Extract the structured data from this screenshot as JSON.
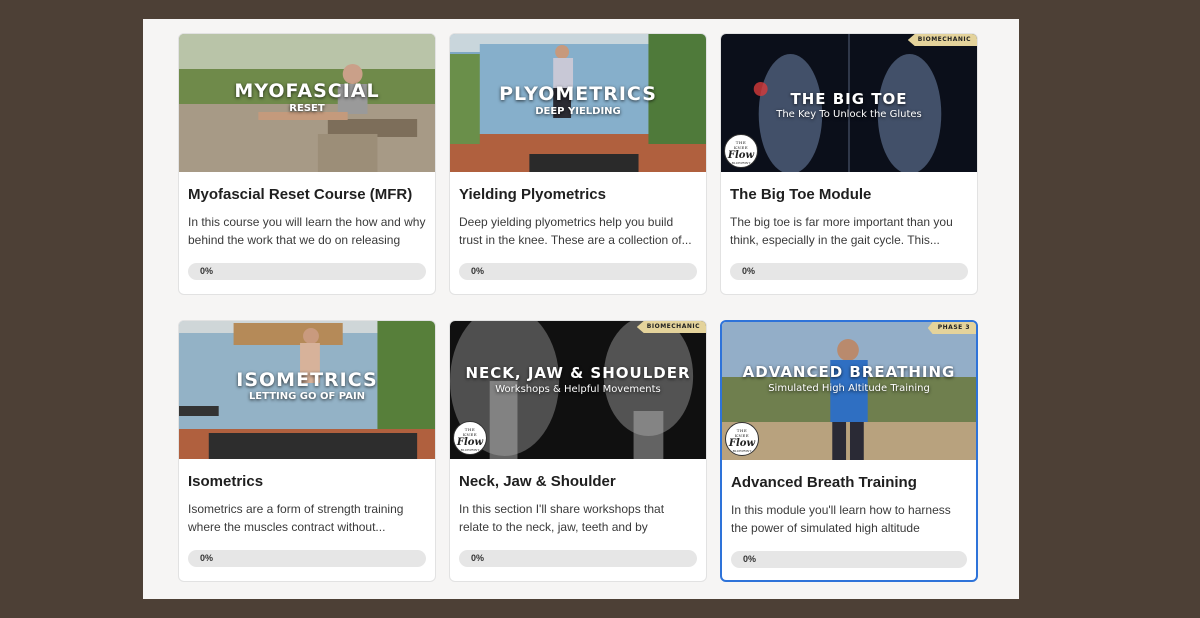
{
  "courses": [
    {
      "title": "Myofascial Reset Course (MFR)",
      "description": "In this course you will learn the how and why behind the work that we do on releasing the...",
      "progress_label": "0%",
      "progress": 0,
      "thumbnail": {
        "title": "MYOFASCIAL",
        "subtitle": "RESET",
        "badge": ""
      }
    },
    {
      "title": "Yielding Plyometrics",
      "description": "Deep yielding plyometrics help you build trust in the knee. These are a collection of...",
      "progress_label": "0%",
      "progress": 0,
      "thumbnail": {
        "title": "PLYOMETRICS",
        "subtitle": "DEEP YIELDING",
        "badge": ""
      }
    },
    {
      "title": "The Big Toe Module",
      "description": "The big toe is far more important than you think, especially in the gait cycle. This...",
      "progress_label": "0%",
      "progress": 0,
      "thumbnail": {
        "title": "THE BIG TOE",
        "subtitle": "The Key To Unlock the Glutes",
        "badge": "BIOMECHANIC"
      }
    },
    {
      "title": "Isometrics",
      "description": "Isometrics are a form of strength training where the muscles contract without...",
      "progress_label": "0%",
      "progress": 0,
      "thumbnail": {
        "title": "ISOMETRICS",
        "subtitle": "LETTING GO OF PAIN",
        "badge": ""
      }
    },
    {
      "title": "Neck, Jaw & Shoulder",
      "description": "In this section I'll share workshops that relate to the neck, jaw, teeth and by extension, the...",
      "progress_label": "0%",
      "progress": 0,
      "thumbnail": {
        "title": "NECK, JAW & SHOULDER",
        "subtitle": "Workshops & Helpful Movements",
        "badge": "BIOMECHANIC"
      }
    },
    {
      "title": "Advanced Breath Training",
      "description": "In this module you'll learn how to harness the power of simulated high altitude breathing,...",
      "progress_label": "0%",
      "progress": 0,
      "thumbnail": {
        "title": "ADVANCED BREATHING",
        "subtitle": "Simulated High Altitude Training",
        "badge": "PHASE 3"
      }
    }
  ],
  "logo": {
    "line1": "THE",
    "line2": "KNEE",
    "line3": "Flow",
    "line4": "BLUEPRINT"
  },
  "colors": {
    "accent": "#2e73d9",
    "badge": "#e4d39b",
    "page_bg": "#4d4036",
    "panel_bg": "#f6f5f4"
  }
}
